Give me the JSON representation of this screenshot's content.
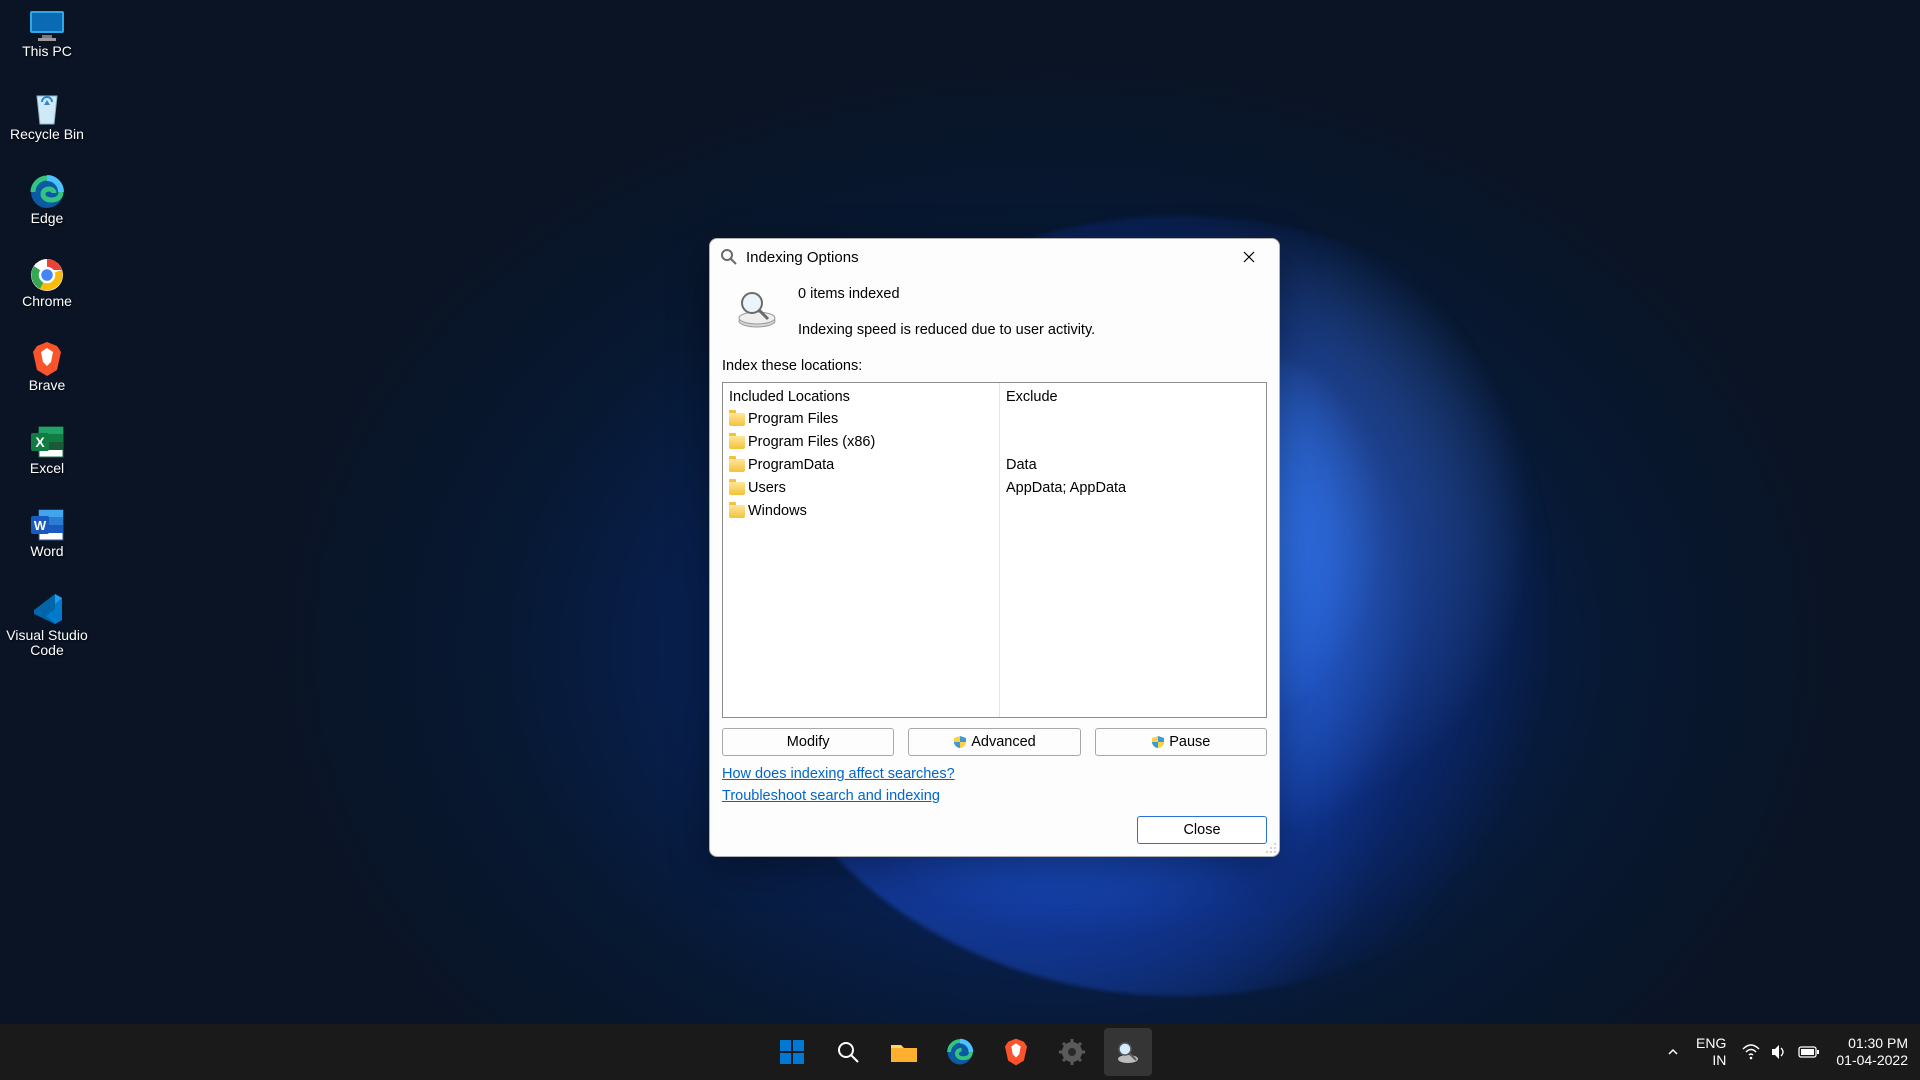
{
  "desktop": {
    "icons": [
      {
        "label": "This PC",
        "name": "this-pc-icon"
      },
      {
        "label": "Recycle Bin",
        "name": "recycle-bin-icon"
      },
      {
        "label": "Edge",
        "name": "edge-icon"
      },
      {
        "label": "Chrome",
        "name": "chrome-icon"
      },
      {
        "label": "Brave",
        "name": "brave-icon"
      },
      {
        "label": "Excel",
        "name": "excel-icon"
      },
      {
        "label": "Word",
        "name": "word-icon"
      },
      {
        "label": "Visual Studio Code",
        "name": "vscode-icon"
      }
    ]
  },
  "dialog": {
    "title": "Indexing Options",
    "status": {
      "count_line": "0 items indexed",
      "info_line": "Indexing speed is reduced due to user activity."
    },
    "locations_label": "Index these locations:",
    "columns": {
      "included_header": "Included Locations",
      "exclude_header": "Exclude"
    },
    "rows": [
      {
        "name": "Program Files",
        "exclude": ""
      },
      {
        "name": "Program Files (x86)",
        "exclude": ""
      },
      {
        "name": "ProgramData",
        "exclude": "Data"
      },
      {
        "name": "Users",
        "exclude": "AppData; AppData"
      },
      {
        "name": "Windows",
        "exclude": ""
      }
    ],
    "buttons": {
      "modify": "Modify",
      "advanced": "Advanced",
      "pause": "Pause",
      "close": "Close"
    },
    "links": {
      "help": "How does indexing affect searches?",
      "troubleshoot": "Troubleshoot search and indexing"
    }
  },
  "taskbar": {
    "tray": {
      "lang1": "ENG",
      "lang2": "IN",
      "time": "01:30 PM",
      "date": "01-04-2022"
    }
  }
}
